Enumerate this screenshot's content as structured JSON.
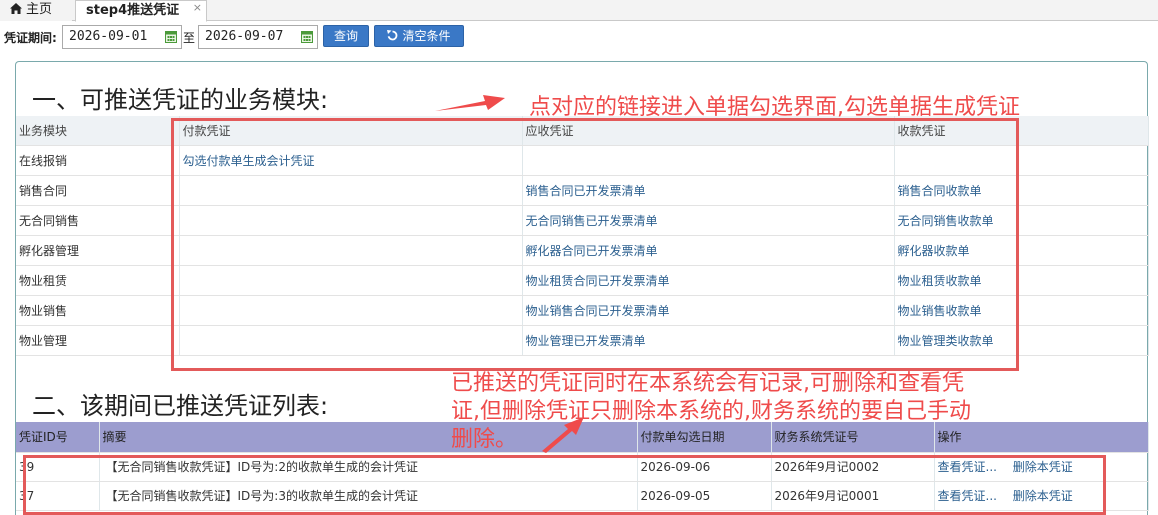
{
  "tabs": {
    "home_label": "主页",
    "active_label": "step4推送凭证",
    "close_glyph": "×"
  },
  "query": {
    "period_label": "凭证期间:",
    "date_from": "2026-09-01",
    "separator": "至",
    "date_to": "2026-09-07",
    "query_button": "查询",
    "clear_button": "清空条件"
  },
  "section1": {
    "title": "一、可推送凭证的业务模块:",
    "headers": [
      "业务模块",
      "付款凭证",
      "应收凭证",
      "收款凭证"
    ],
    "rows": [
      {
        "module": "在线报销",
        "payment": "勾选付款单生成会计凭证",
        "receivable": "",
        "receipt": ""
      },
      {
        "module": "销售合同",
        "payment": "",
        "receivable": "销售合同已开发票清单",
        "receipt": "销售合同收款单"
      },
      {
        "module": "无合同销售",
        "payment": "",
        "receivable": "无合同销售已开发票清单",
        "receipt": "无合同销售收款单"
      },
      {
        "module": "孵化器管理",
        "payment": "",
        "receivable": "孵化器合同已开发票清单",
        "receipt": "孵化器收款单"
      },
      {
        "module": "物业租赁",
        "payment": "",
        "receivable": "物业租赁合同已开发票清单",
        "receipt": "物业租赁收款单"
      },
      {
        "module": "物业销售",
        "payment": "",
        "receivable": "物业销售合同已开发票清单",
        "receipt": "物业销售收款单"
      },
      {
        "module": "物业管理",
        "payment": "",
        "receivable": "物业管理已开发票清单",
        "receipt": "物业管理类收款单"
      }
    ]
  },
  "section2": {
    "title": "二、该期间已推送凭证列表:",
    "headers": [
      "凭证ID号",
      "摘要",
      "付款单勾选日期",
      "财务系统凭证号",
      "操作"
    ],
    "rows": [
      {
        "id": "39",
        "summary": "【无合同销售收款凭证】ID号为:2的收款单生成的会计凭证",
        "date": "2026-09-06",
        "voucher_no": "2026年9月记0002",
        "view": "查看凭证...",
        "delete": "删除本凭证"
      },
      {
        "id": "37",
        "summary": "【无合同销售收款凭证】ID号为:3的收款单生成的会计凭证",
        "date": "2026-09-05",
        "voucher_no": "2026年9月记0001",
        "view": "查看凭证...",
        "delete": "删除本凭证"
      }
    ]
  },
  "annotations": {
    "note1": "点对应的链接进入单据勾选界面,勾选单据生成凭证",
    "note2": "已推送的凭证同时在本系统会有记录,可删除和查看凭证,但删除凭证只删除本系统的,财务系统的要自己手动删除。",
    "color": "#ef4b4b"
  },
  "colors": {
    "accent_button": "#3a78c6",
    "pushed_header": "#9c9dcf",
    "link": "#2b5f8f"
  }
}
